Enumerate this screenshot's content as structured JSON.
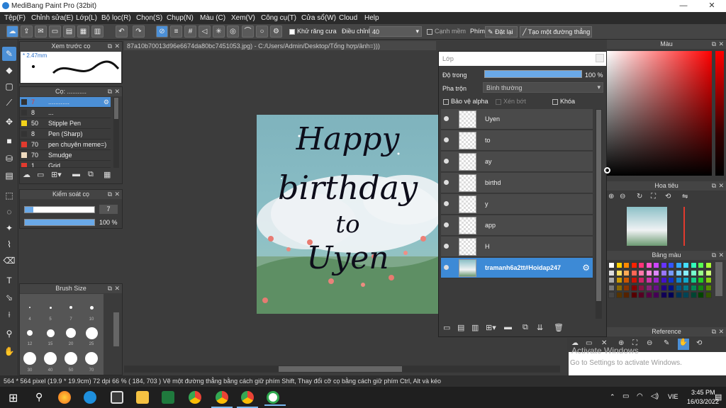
{
  "window": {
    "title": "MediBang Paint Pro (32bit)",
    "min": "—",
    "max": "❐",
    "close": "✕"
  },
  "menu": [
    "Tệp(F)",
    "Chỉnh sửa(E)",
    "Lớp(L)",
    "Bộ lọc(R)",
    "Chọn(S)",
    "Chụp(N)",
    "Màu (C)",
    "Xem(V)",
    "Công cụ(T)",
    "Cửa sổ(W)",
    "Cloud",
    "Help"
  ],
  "toolbar": {
    "antialias_label": "Khử răng cưa",
    "adjust_label": "Điều chỉnh",
    "adjust_value": "40",
    "edge_label": "Cạnh mềm",
    "key_label": "Phím",
    "reset_label": "Đặt lại",
    "line_label": "Tạo một đường thẳng"
  },
  "preview": {
    "title": "Xem trước cọ",
    "size": "* 2.47mm"
  },
  "brushes": {
    "title": "Cọ: ...........",
    "items": [
      {
        "num": "7",
        "name": "............",
        "color": "#333333"
      },
      {
        "num": "8",
        "name": "...",
        "color": "#333333"
      },
      {
        "num": "50",
        "name": "Stipple Pen",
        "color": "#f2d21a"
      },
      {
        "num": "8",
        "name": "Pen (Sharp)",
        "color": "#333333"
      },
      {
        "num": "70",
        "name": "pen chuyên meme=)",
        "color": "#e23a2e"
      },
      {
        "num": "70",
        "name": "Smudge",
        "color": "#f0dcc0"
      },
      {
        "num": "1",
        "name": "Grid",
        "color": "#e23a2e"
      }
    ]
  },
  "brush_control": {
    "title": "Kiểm soát cọ",
    "size": "7",
    "opacity": "100 %"
  },
  "brush_size": {
    "title": "Brush Size",
    "sizes": [
      "3",
      "4",
      "5",
      "7",
      "10",
      "12",
      "15",
      "20",
      "25",
      "30",
      "40",
      "50",
      "70"
    ]
  },
  "document": {
    "title": "87a10b70013d96e6674da80bc7451053.jpg) - C:/Users/Admin/Desktop/Tổng hợp/ảnh=)))"
  },
  "artwork": {
    "lines": [
      "Happy",
      "birthday",
      "to",
      "Uyen"
    ]
  },
  "layers": {
    "title": "Lớp",
    "opacity_label": "Độ trong",
    "opacity_value": "100 %",
    "blend_label": "Pha trộn",
    "blend_value": "Bình thường",
    "protect_alpha": "Bảo vệ alpha",
    "clip": "Xén bớt",
    "lock": "Khóa",
    "items": [
      "Uyen",
      "to",
      "ay",
      "birthd",
      "y",
      "app",
      "H",
      "tramanh6a2tt#Hoidap247"
    ]
  },
  "color_panel": {
    "title": "Màu"
  },
  "navigator": {
    "title": "Hoa tiêu"
  },
  "palette": {
    "title": "Bảng màu",
    "colors": [
      "#ffffff",
      "#ffd000",
      "#ff8800",
      "#ff2200",
      "#ff3377",
      "#ff55cc",
      "#cc44ff",
      "#6633ff",
      "#3355ff",
      "#33aaff",
      "#44ddff",
      "#33ffbb",
      "#55ff55",
      "#aaff33",
      "#dddddd",
      "#ffe066",
      "#ffaa55",
      "#ff6655",
      "#ff77aa",
      "#ff88dd",
      "#dd88ff",
      "#9977ff",
      "#7799ff",
      "#77ccff",
      "#88eeff",
      "#77ffcc",
      "#99ff88",
      "#ccff77",
      "#aaaaaa",
      "#cc9900",
      "#cc5500",
      "#cc1100",
      "#cc2266",
      "#cc33aa",
      "#9922cc",
      "#4411cc",
      "#1133cc",
      "#1188cc",
      "#11aacc",
      "#11cc88",
      "#22cc22",
      "#88cc11",
      "#777777",
      "#886600",
      "#883300",
      "#880000",
      "#881144",
      "#882277",
      "#661188",
      "#220088",
      "#001188",
      "#005588",
      "#007788",
      "#008855",
      "#118811",
      "#558800",
      "#444444",
      "#553300",
      "#552200",
      "#550000",
      "#550022",
      "#550044",
      "#440055",
      "#110055",
      "#000055",
      "#003355",
      "#004455",
      "#004433",
      "#004400",
      "#335500",
      "#000000",
      "#222222",
      "#333333",
      "#111111",
      "#3a2a1a",
      "#2a1a3a",
      "#1a2a3a",
      "#1a3a2a",
      "#3a3a1a",
      "#2a2a2a",
      "#1a1a1a",
      "#0a0a0a",
      "#2b2b2b",
      "#3b3b3b"
    ]
  },
  "reference": {
    "title": "Reference",
    "watermark1": "Activate Windows",
    "watermark2": "Go to Settings to activate Windows."
  },
  "status": {
    "text": "564 * 564 pixel   (19.9 * 19.9cm)   72 dpi   66 %   ( 184, 703 )   Vẽ một đường thẳng bằng cách giữ phím Shift, Thay đổi cỡ cọ bằng cách giữ phím Ctrl, Alt và kéo"
  },
  "taskbar": {
    "lang": "VIE",
    "time": "3:45 PM",
    "date": "16/03/2022"
  },
  "colors": {
    "accent": "#4b8fd6",
    "selected_layer": "#3d8ad6"
  }
}
